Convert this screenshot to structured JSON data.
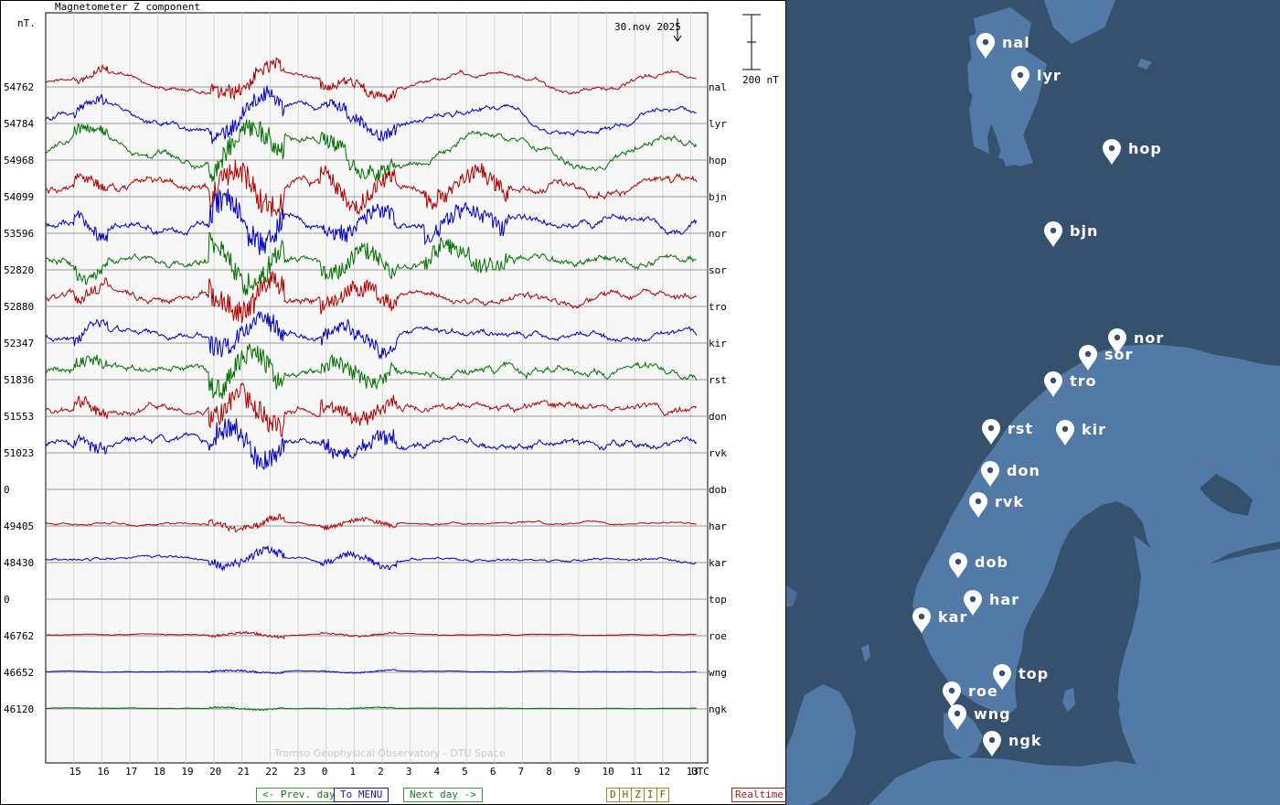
{
  "chart": {
    "title": "Magnetometer Z component",
    "unit_label": "nT.",
    "date_label": "30.nov 2025",
    "scale_label": "200 nT",
    "watermark": "Tromso Geophysical Observatory - DTU Space",
    "utc_label": "UTC"
  },
  "chart_data": {
    "type": "line",
    "title": "Magnetometer Z component",
    "ylabel": "nT.",
    "xlabel": "UTC",
    "x_ticks": [
      "15",
      "16",
      "17",
      "18",
      "19",
      "20",
      "21",
      "22",
      "23",
      "0",
      "1",
      "2",
      "3",
      "4",
      "5",
      "6",
      "7",
      "8",
      "9",
      "10",
      "11",
      "12",
      "13"
    ],
    "x_range_hours": [
      14.0,
      13.6
    ],
    "grid": true,
    "scale_bar_nT": 200,
    "series": [
      {
        "name": "nal",
        "baseline": "54762",
        "color": "#b00000",
        "activity": 0.55
      },
      {
        "name": "lyr",
        "baseline": "54784",
        "color": "#0000c0",
        "activity": 0.7
      },
      {
        "name": "hop",
        "baseline": "54968",
        "color": "#007000",
        "activity": 0.85
      },
      {
        "name": "bjn",
        "baseline": "54099",
        "color": "#b00000",
        "activity": 1.0
      },
      {
        "name": "nor",
        "baseline": "53596",
        "color": "#0000c0",
        "activity": 1.0
      },
      {
        "name": "sor",
        "baseline": "52820",
        "color": "#007000",
        "activity": 1.0
      },
      {
        "name": "tro",
        "baseline": "52880",
        "color": "#b00000",
        "activity": 0.9
      },
      {
        "name": "kir",
        "baseline": "52347",
        "color": "#0000c0",
        "activity": 0.8
      },
      {
        "name": "rst",
        "baseline": "51836",
        "color": "#007000",
        "activity": 0.9
      },
      {
        "name": "don",
        "baseline": "51553",
        "color": "#b00000",
        "activity": 0.85
      },
      {
        "name": "rvk",
        "baseline": "51023",
        "color": "#0000c0",
        "activity": 0.9
      },
      {
        "name": "dob",
        "baseline": "0",
        "color": "#007000",
        "activity": 0
      },
      {
        "name": "har",
        "baseline": "49405",
        "color": "#b00000",
        "activity": 0.25
      },
      {
        "name": "kar",
        "baseline": "48430",
        "color": "#0000c0",
        "activity": 0.35
      },
      {
        "name": "top",
        "baseline": "0",
        "color": "#007000",
        "activity": 0
      },
      {
        "name": "roe",
        "baseline": "46762",
        "color": "#b00000",
        "activity": 0.1
      },
      {
        "name": "wng",
        "baseline": "46652",
        "color": "#0000c0",
        "activity": 0.08
      },
      {
        "name": "ngk",
        "baseline": "46120",
        "color": "#007000",
        "activity": 0.06
      }
    ]
  },
  "nav": {
    "prev_day": "<- Prev. day",
    "menu": "To MENU",
    "next_day": "Next day ->",
    "components": [
      "D",
      "H",
      "Z",
      "I",
      "F"
    ],
    "realtime": "Realtime"
  },
  "map": {
    "stations": [
      "nal",
      "lyr",
      "hop",
      "bjn",
      "nor",
      "sor",
      "tro",
      "rst",
      "kir",
      "don",
      "rvk",
      "dob",
      "har",
      "kar",
      "top",
      "roe",
      "wng",
      "ngk"
    ],
    "colors": {
      "sea": "#36516e",
      "land": "#5379a6",
      "land_dark": "#4a6d97",
      "marker": "#ffffff"
    }
  }
}
